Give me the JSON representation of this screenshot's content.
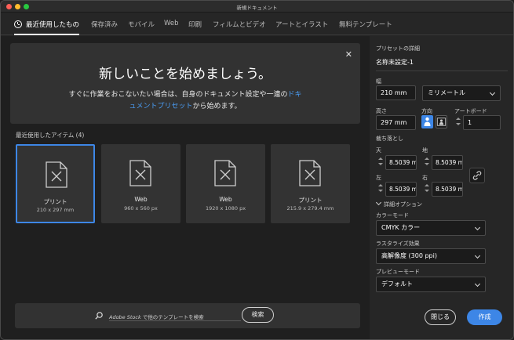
{
  "window": {
    "title": "新規ドキュメント"
  },
  "tabs": [
    {
      "label": "最近使用したもの",
      "active": true
    },
    {
      "label": "保存済み"
    },
    {
      "label": "モバイル"
    },
    {
      "label": "Web"
    },
    {
      "label": "印刷"
    },
    {
      "label": "フィルムとビデオ"
    },
    {
      "label": "アートとイラスト"
    },
    {
      "label": "無料テンプレート"
    }
  ],
  "hero": {
    "title": "新しいことを始めましょう。",
    "desc_line1": "すぐに作業をおこないたい場合は、自身のドキュメント設定や一連の",
    "desc_link1": "ドキ",
    "desc_link2": "ュメントプリセット",
    "desc_tail": "から始めます。",
    "close": "✕"
  },
  "recent": {
    "label": "最近使用したアイテム",
    "count": "(4)",
    "items": [
      {
        "name": "プリント",
        "size": "210 x 297 mm",
        "selected": true
      },
      {
        "name": "Web",
        "size": "960 x 560 px"
      },
      {
        "name": "Web",
        "size": "1920 x 1080 px"
      },
      {
        "name": "プリント",
        "size": "215.9 x 279.4 mm"
      }
    ]
  },
  "search": {
    "brand": "Adobe Stock",
    "text": " で他のテンプレートを検索",
    "button": "検索"
  },
  "preset": {
    "section_label": "プリセットの詳細",
    "name": "名称未設定-1",
    "width_label": "幅",
    "width_value": "210 mm",
    "unit_value": "ミリメートル",
    "height_label": "高さ",
    "height_value": "297 mm",
    "orientation_label": "方向",
    "artboards_label": "アートボード",
    "artboards_value": "1",
    "bleed_label": "裁ち落とし",
    "bleed_top_label": "天",
    "bleed_top_value": "8.5039 m",
    "bleed_bottom_label": "地",
    "bleed_bottom_value": "8.5039 m",
    "bleed_left_label": "左",
    "bleed_left_value": "8.5039 m",
    "bleed_right_label": "右",
    "bleed_right_value": "8.5039 m",
    "advanced_label": "詳細オプション",
    "color_mode_label": "カラーモード",
    "color_mode_value": "CMYK カラー",
    "raster_label": "ラスタライズ効果",
    "raster_value": "高解像度 (300 ppi)",
    "preview_label": "プレビューモード",
    "preview_value": "デフォルト"
  },
  "actions": {
    "close": "閉じる",
    "create": "作成"
  },
  "colors": {
    "accent": "#3d86e6",
    "background": "#1f1f1f",
    "panel": "#262626",
    "card": "#333333"
  }
}
